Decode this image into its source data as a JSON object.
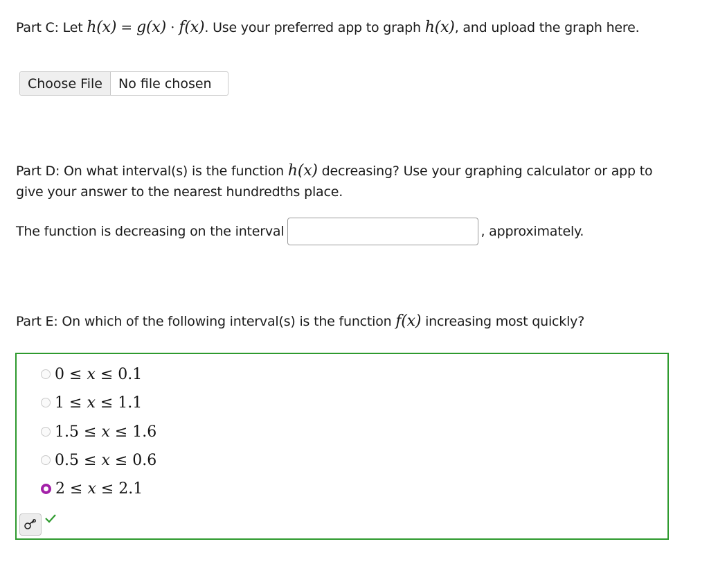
{
  "partC": {
    "prefix": "Part C: Let ",
    "math_h": "h(x)",
    "equals": " = ",
    "math_g": "g(x)",
    "dot": " · ",
    "math_f": "f(x)",
    "middle": ". Use your preferred app to graph ",
    "math_h2": "h(x)",
    "suffix": ", and upload the graph here."
  },
  "file_upload": {
    "button_label": "Choose File",
    "status": "No file chosen"
  },
  "partD": {
    "prefix": "Part D: On what interval(s) is the function ",
    "math_h": "h(x)",
    "suffix": " decreasing? Use your graphing calculator or app to give your answer to the nearest hundredths place.",
    "sentence_before": "The function is decreasing on the interval",
    "answer_value": "",
    "answer_placeholder": "",
    "sentence_after": ", approximately."
  },
  "partE": {
    "prefix": "Part E: On which of the following interval(s) is the function ",
    "math_f": "f(x)",
    "suffix": " increasing most quickly?",
    "choices": [
      {
        "left": "0",
        "var": "x",
        "right": "0.1",
        "selected": false
      },
      {
        "left": "1",
        "var": "x",
        "right": "1.1",
        "selected": false
      },
      {
        "left": "1.5",
        "var": "x",
        "right": "1.6",
        "selected": false
      },
      {
        "left": "0.5",
        "var": "x",
        "right": "0.6",
        "selected": false
      },
      {
        "left": "2",
        "var": "x",
        "right": "2.1",
        "selected": true
      }
    ],
    "leq": "≤",
    "result_icon": "checkmark-icon",
    "key_icon": "key-icon"
  },
  "colors": {
    "correct_border": "#2e9a2e",
    "selected_radio": "#a321a8",
    "check": "#2e9a2e"
  }
}
